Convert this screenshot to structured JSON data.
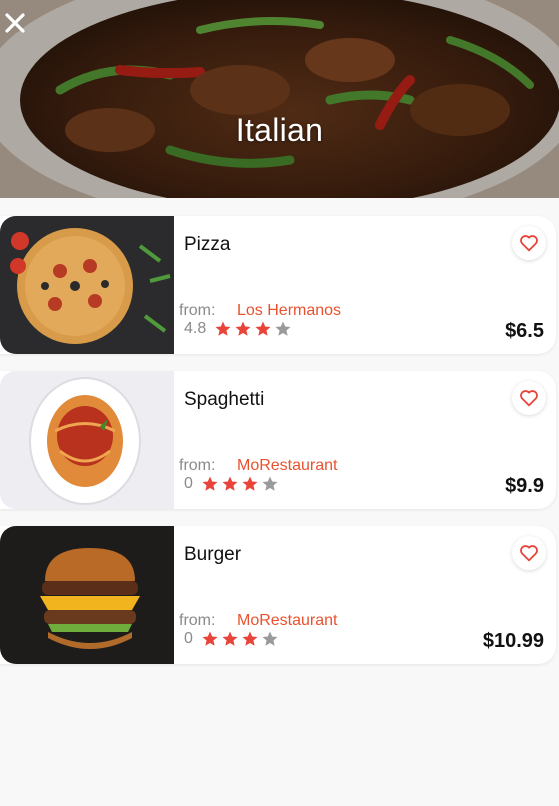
{
  "header": {
    "title": "Italian",
    "close_icon": "close-icon"
  },
  "items": [
    {
      "name": "Pizza",
      "from_label": "from:",
      "restaurant": "Los Hermanos",
      "rating": "4.8",
      "stars_filled": 3,
      "stars_total": 4,
      "price": "$6.5",
      "favorite_icon": "heart-outline-icon"
    },
    {
      "name": "Spaghetti",
      "from_label": "from:",
      "restaurant": "MoRestaurant",
      "rating": "0",
      "stars_filled": 3,
      "stars_total": 4,
      "price": "$9.9",
      "favorite_icon": "heart-outline-icon"
    },
    {
      "name": "Burger",
      "from_label": "from:",
      "restaurant": "MoRestaurant",
      "rating": "0",
      "stars_filled": 3,
      "stars_total": 4,
      "price": "$10.99",
      "favorite_icon": "heart-outline-icon"
    }
  ],
  "colors": {
    "accent": "#e8522f",
    "star_filled": "#e8443a",
    "star_empty": "#9a9a9a"
  }
}
